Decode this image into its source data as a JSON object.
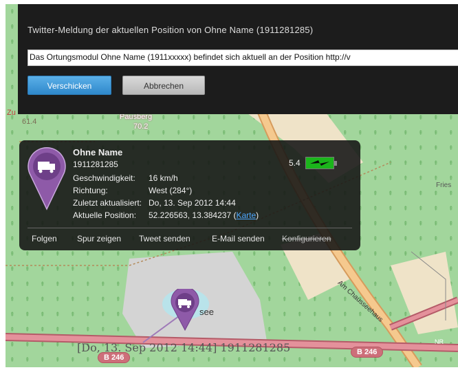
{
  "dialog": {
    "title": "Twitter-Meldung der aktuellen Position von Ohne Name (1911281285)",
    "message_value": "Das Ortungsmodul Ohne Name (1911xxxxx) befindet sich aktuell an der Position http://v",
    "send_label": "Verschicken",
    "cancel_label": "Abbrechen"
  },
  "popup": {
    "name": "Ohne Name",
    "id": "1911281285",
    "signal": "5.4",
    "details": [
      {
        "label": "Geschwindigkeit:",
        "value": "16 km/h"
      },
      {
        "label": "Richtung:",
        "value": "West (284°)"
      },
      {
        "label": "Zuletzt aktualisiert:",
        "value": "Do, 13. Sep 2012 14:44"
      },
      {
        "label": "Aktuelle Position:",
        "value": "52.226563, 13.384237 ("
      }
    ],
    "position_link": "Karte",
    "position_close": ")",
    "actions": {
      "follow": "Folgen",
      "track": "Spur zeigen",
      "tweet": "Tweet senden",
      "email": "E-Mail senden",
      "configure": "Konfigurieren"
    },
    "colors": {
      "battery": "#1bb51b",
      "pin": "#8e5aa8"
    }
  },
  "map": {
    "labels": {
      "top_left_a": "Zu",
      "top_left_b": "61.4",
      "hill_name": "Pausberg",
      "hill_height": "70.2",
      "place_right": "Fries",
      "road_name": "Am Chausseehaus",
      "lake_suffix": "see",
      "road_b246_left": "B 246",
      "road_b246_right": "B 246",
      "nr": "NR"
    },
    "track_label": "[Do, 13. Sep 2012 14:44] 1911281285"
  }
}
